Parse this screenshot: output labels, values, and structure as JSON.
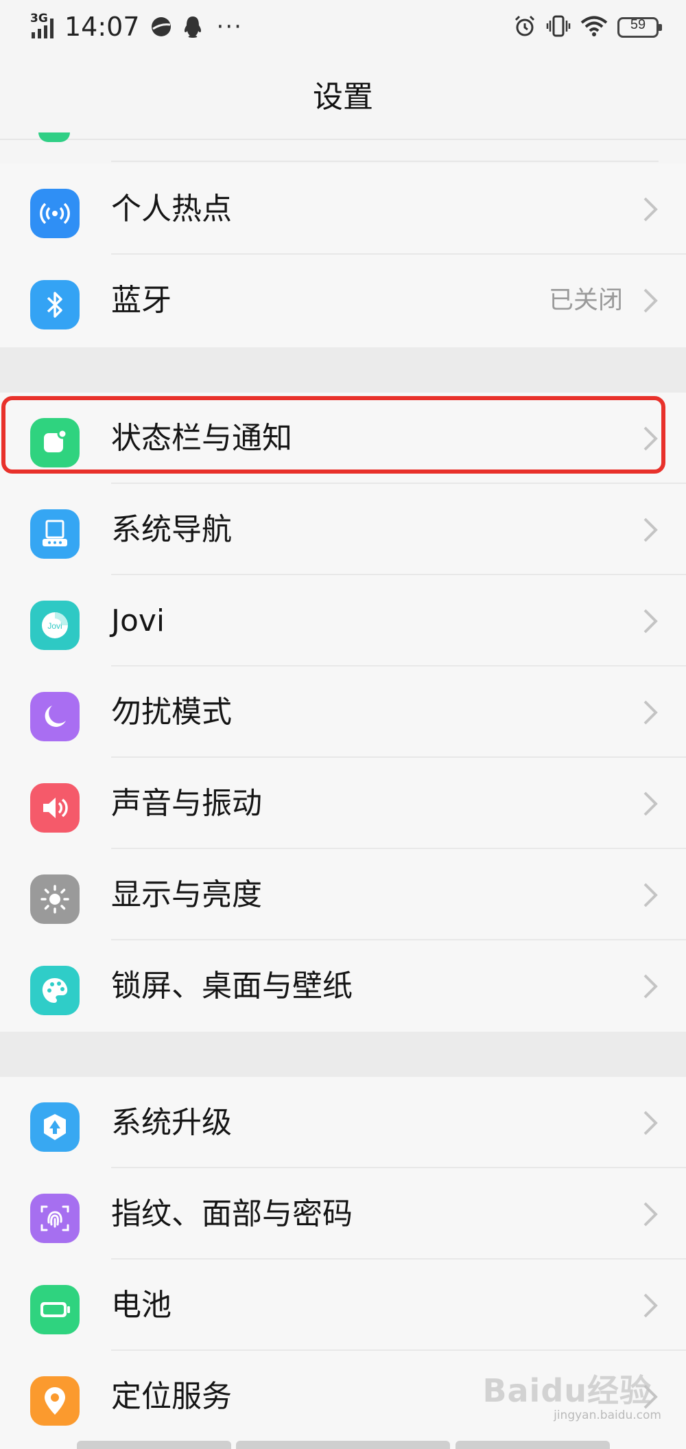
{
  "status_bar": {
    "network": "3G",
    "time": "14:07",
    "battery": "59"
  },
  "page_title": "设置",
  "groups": [
    {
      "items": [
        {
          "id": "hotspot",
          "label": "个人热点",
          "icon": "hotspot-icon",
          "color": "#2f8ff5"
        },
        {
          "id": "bluetooth",
          "label": "蓝牙",
          "value": "已关闭",
          "icon": "bluetooth-icon",
          "color": "#34a3f4"
        }
      ]
    },
    {
      "items": [
        {
          "id": "statusbar-notifications",
          "label": "状态栏与通知",
          "icon": "notification-icon",
          "color": "#2fd37f",
          "highlighted": true
        },
        {
          "id": "system-navigation",
          "label": "系统导航",
          "icon": "navigation-icon",
          "color": "#35a6f3"
        },
        {
          "id": "jovi",
          "label": "Jovi",
          "icon": "jovi-icon",
          "color": "#2ec9c4"
        },
        {
          "id": "do-not-disturb",
          "label": "勿扰模式",
          "icon": "moon-icon",
          "color": "#a96ef2"
        },
        {
          "id": "sound-vibration",
          "label": "声音与振动",
          "icon": "speaker-icon",
          "color": "#f55a6a"
        },
        {
          "id": "display-brightness",
          "label": "显示与亮度",
          "icon": "sun-icon",
          "color": "#9a9a9a"
        },
        {
          "id": "lockscreen-wallpaper",
          "label": "锁屏、桌面与壁纸",
          "icon": "palette-icon",
          "color": "#2fcdc8"
        }
      ]
    },
    {
      "items": [
        {
          "id": "system-update",
          "label": "系统升级",
          "icon": "update-icon",
          "color": "#38a8f2"
        },
        {
          "id": "fingerprint-face-password",
          "label": "指纹、面部与密码",
          "icon": "fingerprint-icon",
          "color": "#a66ff0"
        },
        {
          "id": "battery",
          "label": "电池",
          "icon": "battery-icon",
          "color": "#2fd37f"
        },
        {
          "id": "location",
          "label": "定位服务",
          "icon": "location-icon",
          "color": "#fb9a2e"
        }
      ]
    }
  ],
  "watermark": {
    "text": "Baidu经验",
    "sub": "jingyan.baidu.com"
  }
}
